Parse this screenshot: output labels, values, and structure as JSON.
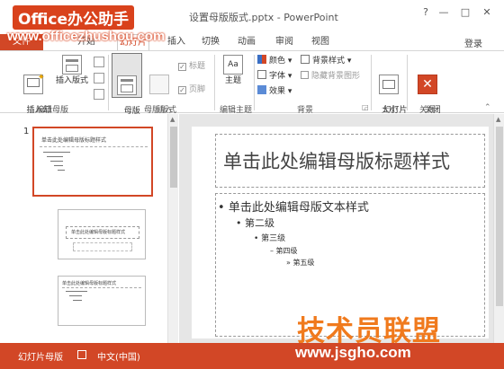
{
  "window": {
    "doc_title": "设置母版版式.pptx - PowerPoint",
    "help": "?",
    "minimize": "—",
    "maximize": "□",
    "close": "✕"
  },
  "watermark": {
    "logo_text": "Office办公助手",
    "url": "www.officezhushou.com"
  },
  "tabs": {
    "file": "文件",
    "home": "开始",
    "master": "幻灯片母版",
    "insert": "插入",
    "transitions": "切换",
    "animations": "动画",
    "review": "审阅",
    "view": "视图",
    "login": "登录"
  },
  "ribbon": {
    "insert_master": "插入幻\n灯片母版",
    "insert_layout": "插入版式",
    "master_layout": "母版\n版式",
    "insert_placeholder": "插入\n占位符",
    "cb_title": "标题",
    "cb_footer": "页脚",
    "theme": "主题",
    "colors": "颜色",
    "fonts": "字体",
    "effects": "效果",
    "bg_styles": "背景样式",
    "hide_bg": "隐藏背景图形",
    "slide_size": "幻灯片\n大小",
    "close_master": "关闭\n母版视图",
    "group_edit_master": "编辑母版",
    "group_master_layout": "母版版式",
    "group_edit_theme": "编辑主题",
    "group_background": "背景",
    "group_size": "大小",
    "group_close": "关闭"
  },
  "thumbnails": {
    "slide_number": "1",
    "thumb1_title": "单击此处编辑母版标题样式",
    "thumb2_title": "单击此处编辑母版标题样式",
    "thumb3_title": "单击此处编辑母版标题样式"
  },
  "slide": {
    "title": "单击此处编辑母版标题样式",
    "level1": "单击此处编辑母版文本样式",
    "level2": "第二级",
    "level3": "第三级",
    "level4": "第四级",
    "level5": "第五级"
  },
  "status": {
    "view": "幻灯片母版",
    "language": "中文(中国)"
  },
  "brand": {
    "name": "技术员联盟",
    "url": "www.jsgho.com"
  },
  "colors": {
    "accent": "#d24726",
    "logo_bg": "#d9421c",
    "brand": "#f07a1d"
  }
}
